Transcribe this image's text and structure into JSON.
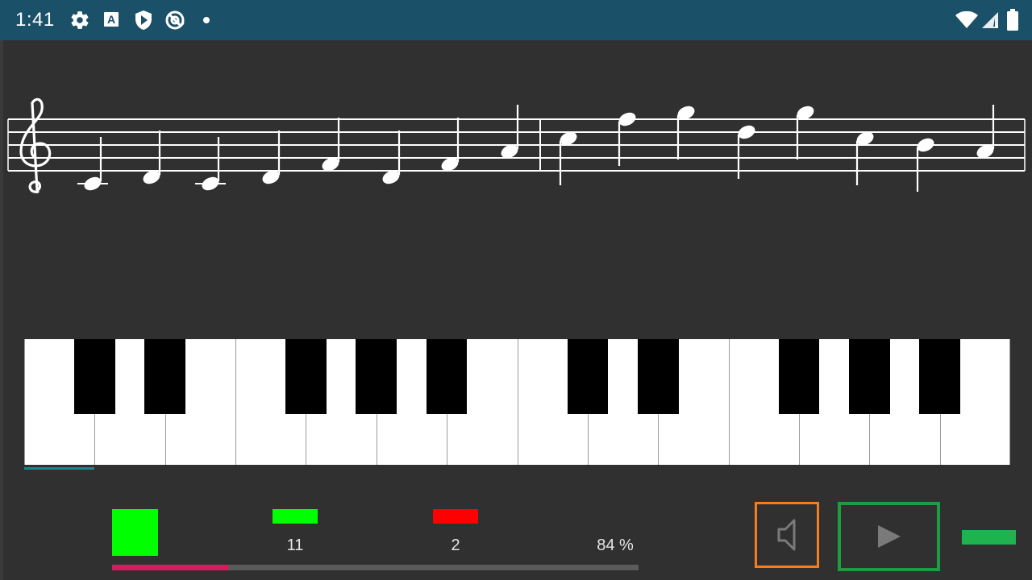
{
  "status_bar": {
    "time": "1:41",
    "left_icons": [
      "settings-icon",
      "a-icon",
      "shield-icon",
      "at-sync-icon",
      "dot-icon"
    ],
    "right_icons": [
      "wifi-icon",
      "cell-signal-icon",
      "battery-icon"
    ]
  },
  "staff": {
    "clef": "treble-clef-icon",
    "notes": [
      {
        "pitch": "C4",
        "stem": "up"
      },
      {
        "pitch": "D4",
        "stem": "up"
      },
      {
        "pitch": "C4",
        "stem": "up"
      },
      {
        "pitch": "D4",
        "stem": "up"
      },
      {
        "pitch": "F4",
        "stem": "up"
      },
      {
        "pitch": "D4",
        "stem": "up"
      },
      {
        "pitch": "F4",
        "stem": "up"
      },
      {
        "pitch": "A4",
        "stem": "up"
      },
      {
        "pitch": "C5",
        "stem": "down"
      },
      {
        "pitch": "F5",
        "stem": "down"
      },
      {
        "pitch": "G5",
        "stem": "down"
      },
      {
        "pitch": "D5",
        "stem": "down"
      },
      {
        "pitch": "G5",
        "stem": "down"
      },
      {
        "pitch": "C5",
        "stem": "down"
      },
      {
        "pitch": "B4",
        "stem": "down"
      },
      {
        "pitch": "A4",
        "stem": "up"
      }
    ],
    "barline_after_note": 8
  },
  "piano": {
    "white_keys": 14,
    "black_key_after_white": [
      0,
      1,
      3,
      4,
      5,
      7,
      8,
      10,
      11,
      12
    ]
  },
  "stats": {
    "correct_count": "11",
    "wrong_count": "2",
    "accuracy": "84 %",
    "progress": 0.22
  },
  "colors": {
    "status_bar": "#1b5069",
    "background": "#303030",
    "correct": "#00ff00",
    "wrong": "#ff0000",
    "progress": "#d81b60",
    "sound_button_border": "#f57c1f",
    "play_button_border": "#1f9c3f"
  },
  "controls": {
    "sound_icon": "speaker-icon",
    "play_icon": "play-icon"
  }
}
